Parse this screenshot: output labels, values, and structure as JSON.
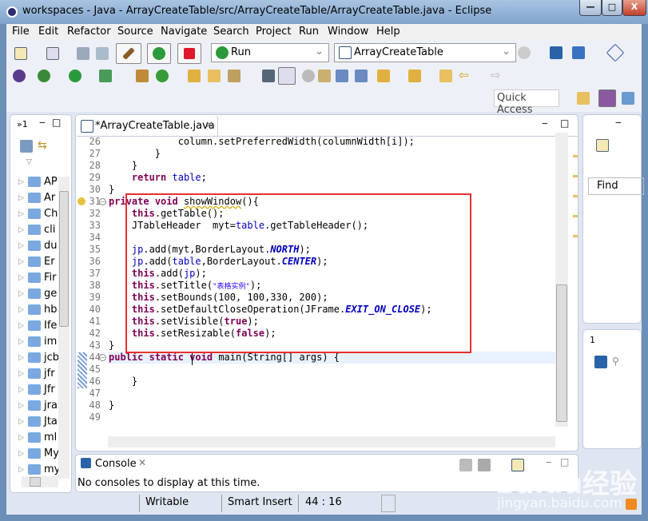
{
  "window": {
    "title": "workspaces - Java - ArrayCreateTable/src/ArrayCreateTable/ArrayCreateTable.java - Eclipse",
    "minimize": "—",
    "maximize": "□",
    "close": "X"
  },
  "menu": [
    "File",
    "Edit",
    "Refactor",
    "Source",
    "Navigate",
    "Search",
    "Project",
    "Run",
    "Window",
    "Help"
  ],
  "toolbar": {
    "run_config": "Run",
    "launch_target": "ArrayCreateTable",
    "quick_access": "Quick Access"
  },
  "left_panel": {
    "tab_label": "»1",
    "items": [
      "AP",
      "Ar",
      "Ch",
      "cli",
      "du",
      "Er",
      "Fir",
      "ge",
      "hb",
      "Ife",
      "im",
      "jcb",
      "jfr",
      "Jfr",
      "jra",
      "Jta",
      "ml",
      "My",
      "my"
    ]
  },
  "editor": {
    "tab_label": "*ArrayCreateTable.java",
    "lines": [
      {
        "n": "26",
        "t": [
          [
            "            column.setPreferredWidth(columnWidth[i]);",
            ""
          ]
        ]
      },
      {
        "n": "27",
        "t": [
          [
            "        }",
            ""
          ]
        ]
      },
      {
        "n": "28",
        "t": [
          [
            "    }",
            ""
          ]
        ]
      },
      {
        "n": "29",
        "t": [
          [
            "    ",
            ""
          ],
          [
            "return",
            "kw"
          ],
          [
            " ",
            ""
          ],
          [
            "table",
            "fld"
          ],
          [
            ";",
            ""
          ]
        ]
      },
      {
        "n": "30",
        "t": [
          [
            "}",
            ""
          ]
        ]
      },
      {
        "n": "31",
        "t": [
          [
            "private",
            "kw"
          ],
          [
            " ",
            ""
          ],
          [
            "void",
            "kw"
          ],
          [
            " ",
            ""
          ],
          [
            "showWindow",
            "warn"
          ],
          [
            "(){",
            ""
          ]
        ]
      },
      {
        "n": "32",
        "t": [
          [
            "    ",
            ""
          ],
          [
            "this",
            "kw"
          ],
          [
            ".getTable();",
            ""
          ]
        ]
      },
      {
        "n": "33",
        "t": [
          [
            "    JTableHeader  myt=",
            ""
          ],
          [
            "table",
            "fld"
          ],
          [
            ".getTableHeader();",
            ""
          ]
        ]
      },
      {
        "n": "34",
        "t": [
          [
            "",
            ""
          ]
        ]
      },
      {
        "n": "35",
        "t": [
          [
            "    ",
            ""
          ],
          [
            "jp",
            "fld"
          ],
          [
            ".add(myt,BorderLayout.",
            ""
          ],
          [
            "NORTH",
            "sfld"
          ],
          [
            ");",
            ""
          ]
        ]
      },
      {
        "n": "36",
        "t": [
          [
            "    ",
            ""
          ],
          [
            "jp",
            "fld"
          ],
          [
            ".add(",
            ""
          ],
          [
            "table",
            "fld"
          ],
          [
            ",BorderLayout.",
            ""
          ],
          [
            "CENTER",
            "sfld"
          ],
          [
            ");",
            ""
          ]
        ]
      },
      {
        "n": "37",
        "t": [
          [
            "    ",
            ""
          ],
          [
            "this",
            "kw"
          ],
          [
            ".add(",
            ""
          ],
          [
            "jp",
            "fld"
          ],
          [
            ");",
            ""
          ]
        ]
      },
      {
        "n": "38",
        "t": [
          [
            "    ",
            ""
          ],
          [
            "this",
            "kw"
          ],
          [
            ".setTitle(",
            ""
          ],
          [
            "\"表格实例\"",
            "str"
          ],
          [
            ");",
            ""
          ]
        ]
      },
      {
        "n": "39",
        "t": [
          [
            "    ",
            ""
          ],
          [
            "this",
            "kw"
          ],
          [
            ".setBounds(100, 100,330, 200);",
            ""
          ]
        ]
      },
      {
        "n": "40",
        "t": [
          [
            "    ",
            ""
          ],
          [
            "this",
            "kw"
          ],
          [
            ".setDefaultCloseOperation(JFrame.",
            ""
          ],
          [
            "EXIT_ON_CLOSE",
            "sfld"
          ],
          [
            ");",
            ""
          ]
        ]
      },
      {
        "n": "41",
        "t": [
          [
            "    ",
            ""
          ],
          [
            "this",
            "kw"
          ],
          [
            ".setVisible(",
            ""
          ],
          [
            "true",
            "kw"
          ],
          [
            ");",
            ""
          ]
        ]
      },
      {
        "n": "42",
        "t": [
          [
            "    ",
            ""
          ],
          [
            "this",
            "kw"
          ],
          [
            ".setResizable(",
            ""
          ],
          [
            "false",
            "kw"
          ],
          [
            ");",
            ""
          ]
        ]
      },
      {
        "n": "43",
        "t": [
          [
            "}",
            ""
          ]
        ]
      },
      {
        "n": "44",
        "t": [
          [
            "public",
            "kw"
          ],
          [
            " ",
            ""
          ],
          [
            "static",
            "kw"
          ],
          [
            " ",
            ""
          ],
          [
            "void",
            "kw"
          ],
          [
            " main(String[] args) {",
            ""
          ]
        ]
      },
      {
        "n": "45",
        "t": [
          [
            "",
            ""
          ]
        ]
      },
      {
        "n": "46",
        "t": [
          [
            "    }",
            ""
          ]
        ]
      },
      {
        "n": "47",
        "t": [
          [
            "",
            ""
          ]
        ]
      },
      {
        "n": "48",
        "t": [
          [
            "}",
            ""
          ]
        ]
      },
      {
        "n": "49",
        "t": [
          [
            "",
            ""
          ]
        ]
      }
    ]
  },
  "right_panel": {
    "tab_label": "1",
    "find_label": "Find",
    "tab2_label": "1"
  },
  "console": {
    "tab_label": "Console",
    "message": "No consoles to display at this time."
  },
  "status": {
    "writable": "Writable",
    "insert_mode": "Smart Insert",
    "position": "44 : 16"
  },
  "watermark": {
    "line1": "Baidu经验",
    "line2": "jingyan.baidu.com"
  },
  "colors": {
    "keyword": "#7f0055",
    "field": "#0000c0",
    "string": "#2a00ff",
    "highlight_box": "#e8302f",
    "current_line": "#e8f2fe"
  }
}
